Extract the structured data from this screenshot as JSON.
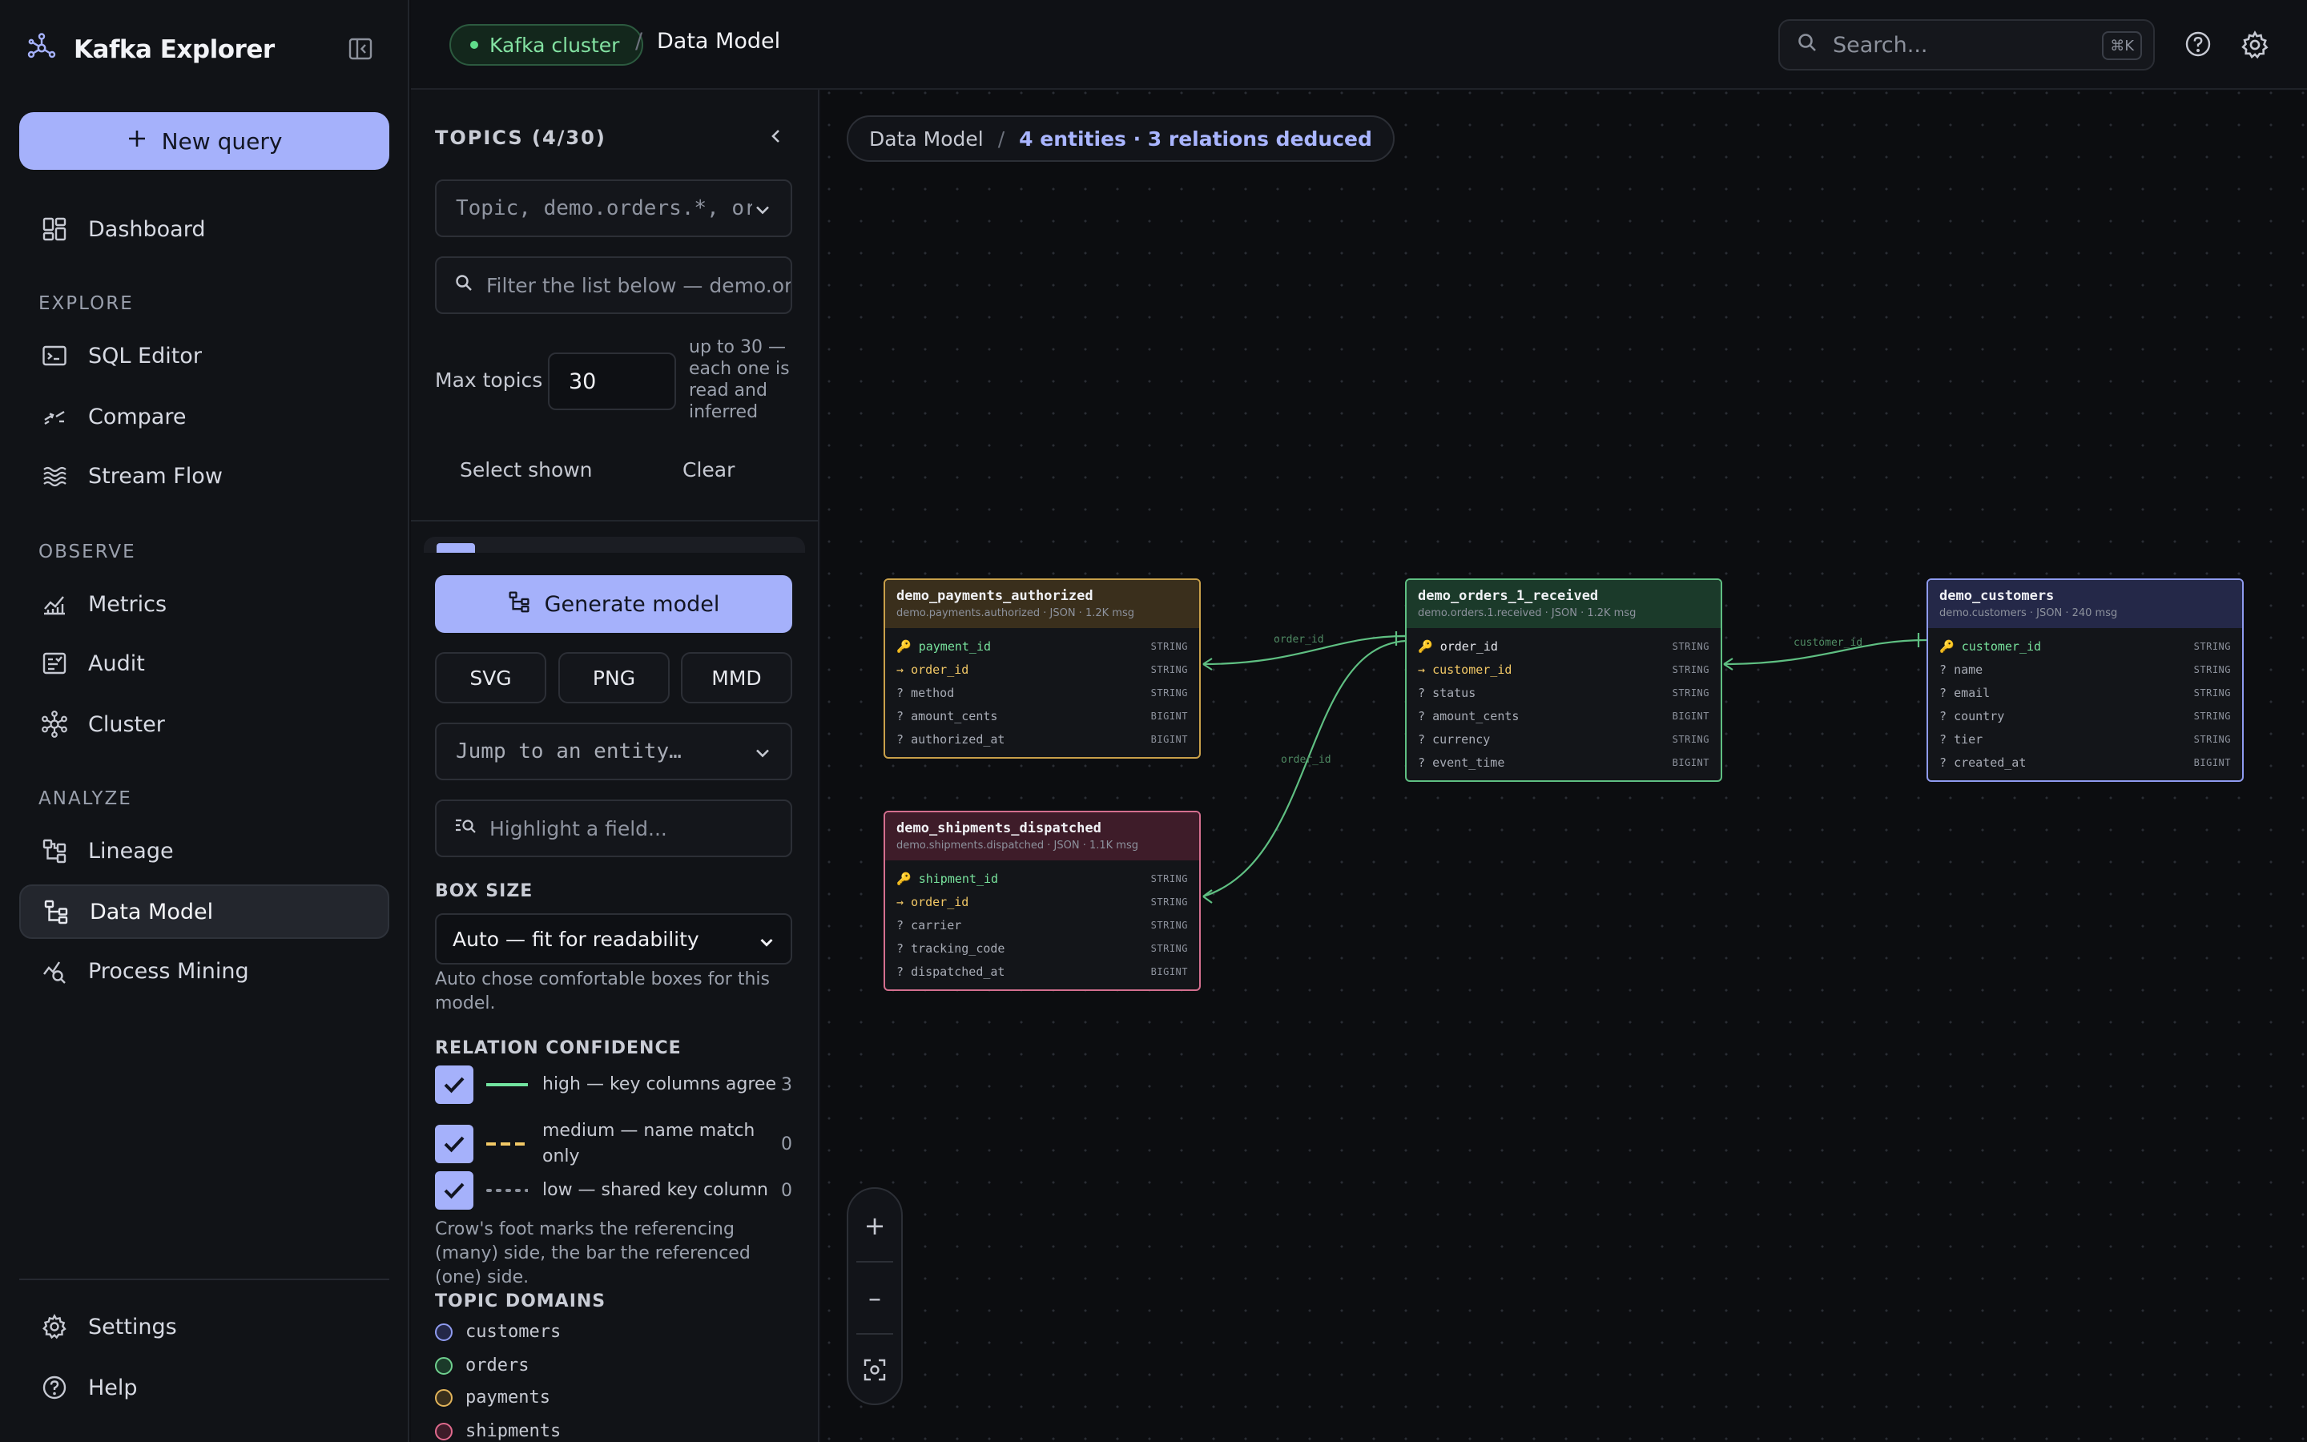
{
  "app": {
    "title": "Kafka Explorer"
  },
  "nav": {
    "new_query": "New query",
    "items_top": [
      {
        "label": "Dashboard",
        "icon": "dashboard-icon"
      }
    ],
    "sections": [
      {
        "title": "EXPLORE",
        "items": [
          {
            "label": "SQL Editor",
            "icon": "terminal-icon"
          },
          {
            "label": "Compare",
            "icon": "compare-icon"
          },
          {
            "label": "Stream Flow",
            "icon": "waves-icon"
          }
        ]
      },
      {
        "title": "OBSERVE",
        "items": [
          {
            "label": "Metrics",
            "icon": "metrics-icon"
          },
          {
            "label": "Audit",
            "icon": "audit-icon"
          },
          {
            "label": "Cluster",
            "icon": "cluster-icon"
          }
        ]
      },
      {
        "title": "ANALYZE",
        "items": [
          {
            "label": "Lineage",
            "icon": "lineage-icon"
          },
          {
            "label": "Data Model",
            "icon": "data-model-icon",
            "active": true
          },
          {
            "label": "Process Mining",
            "icon": "process-mining-icon"
          }
        ]
      }
    ],
    "footer": [
      {
        "label": "Settings",
        "icon": "gear-icon"
      },
      {
        "label": "Help",
        "icon": "help-icon"
      }
    ]
  },
  "topbar": {
    "cluster": "Kafka cluster",
    "separator": "/",
    "page": "Data Model",
    "search_placeholder": "Search...",
    "search_shortcut": "⌘K"
  },
  "topics_panel": {
    "title": "TOPICS (4/30)",
    "topic_pattern_placeholder": "Topic, demo.orders.*, or …",
    "filter_placeholder": "Filter the list below — demo.orders",
    "max_topics_label": "Max topics",
    "max_topics_value": "30",
    "max_topics_note": "up to 30 — each one is read and inferred",
    "select_shown": "Select shown",
    "clear": "Clear",
    "generate": "Generate model",
    "exports": [
      "SVG",
      "PNG",
      "MMD"
    ],
    "jump_placeholder": "Jump to an entity…",
    "highlight_placeholder": "Highlight a field...",
    "box_size_title": "BOX SIZE",
    "box_size_value": "Auto — fit for readability",
    "box_size_note": "Auto chose comfortable boxes for this model.",
    "confidence_title": "RELATION CONFIDENCE",
    "confidence": [
      {
        "label": "high — key columns agree",
        "count": "3",
        "color": "#72e3a0",
        "style": "solid"
      },
      {
        "label": "medium — name match only",
        "count": "0",
        "color": "#f2c866",
        "style": "dashed"
      },
      {
        "label": "low — shared key column",
        "count": "0",
        "color": "#8d929d",
        "style": "dotted"
      }
    ],
    "confidence_note": "Crow's foot marks the referencing (many) side, the bar the referenced (one) side.",
    "domains_title": "TOPIC DOMAINS",
    "domains": [
      {
        "name": "customers",
        "color": "#8f9bf0"
      },
      {
        "name": "orders",
        "color": "#6fcf8e"
      },
      {
        "name": "payments",
        "color": "#e2b45a"
      },
      {
        "name": "shipments",
        "color": "#e06a8d"
      }
    ]
  },
  "canvas": {
    "crumb_root": "Data Model",
    "crumb_sep": "/",
    "crumb_summary": "4 entities · 3 relations deduced",
    "edge_labels": [
      "order_id",
      "order_id",
      "customer_id"
    ],
    "entities": [
      {
        "name": "demo_payments_authorized",
        "meta": "demo.payments.authorized · JSON · 1.2K msg",
        "border": "#c9a04a",
        "header": "#3a2f1c",
        "fields": [
          {
            "mark": "🔑",
            "name": "payment_id",
            "type": "STRING",
            "kind": "pk"
          },
          {
            "mark": "→",
            "name": "order_id",
            "type": "STRING",
            "kind": "fk"
          },
          {
            "mark": "?",
            "name": "method",
            "type": "STRING",
            "kind": ""
          },
          {
            "mark": "?",
            "name": "amount_cents",
            "type": "BIGINT",
            "kind": ""
          },
          {
            "mark": "?",
            "name": "authorized_at",
            "type": "BIGINT",
            "kind": ""
          }
        ]
      },
      {
        "name": "demo_shipments_dispatched",
        "meta": "demo.shipments.dispatched · JSON · 1.1K msg",
        "border": "#d46f8f",
        "header": "#3e1c29",
        "fields": [
          {
            "mark": "🔑",
            "name": "shipment_id",
            "type": "STRING",
            "kind": "pk"
          },
          {
            "mark": "→",
            "name": "order_id",
            "type": "STRING",
            "kind": "fk"
          },
          {
            "mark": "?",
            "name": "carrier",
            "type": "STRING",
            "kind": ""
          },
          {
            "mark": "?",
            "name": "tracking_code",
            "type": "STRING",
            "kind": ""
          },
          {
            "mark": "?",
            "name": "dispatched_at",
            "type": "BIGINT",
            "kind": ""
          }
        ]
      },
      {
        "name": "demo_orders_1_received",
        "meta": "demo.orders.1.received · JSON · 1.2K msg",
        "border": "#5fbf82",
        "header": "#1b3a2a",
        "fields": [
          {
            "mark": "🔑",
            "name": "order_id",
            "type": "STRING",
            "kind": "pk"
          },
          {
            "mark": "→",
            "name": "customer_id",
            "type": "STRING",
            "kind": "fk"
          },
          {
            "mark": "?",
            "name": "status",
            "type": "STRING",
            "kind": ""
          },
          {
            "mark": "?",
            "name": "amount_cents",
            "type": "BIGINT",
            "kind": ""
          },
          {
            "mark": "?",
            "name": "currency",
            "type": "STRING",
            "kind": ""
          },
          {
            "mark": "?",
            "name": "event_time",
            "type": "BIGINT",
            "kind": ""
          }
        ]
      },
      {
        "name": "demo_customers",
        "meta": "demo.customers · JSON · 240 msg",
        "border": "#8f9bf0",
        "header": "#242848",
        "fields": [
          {
            "mark": "🔑",
            "name": "customer_id",
            "type": "STRING",
            "kind": "pk"
          },
          {
            "mark": "?",
            "name": "name",
            "type": "STRING",
            "kind": ""
          },
          {
            "mark": "?",
            "name": "email",
            "type": "STRING",
            "kind": ""
          },
          {
            "mark": "?",
            "name": "country",
            "type": "STRING",
            "kind": ""
          },
          {
            "mark": "?",
            "name": "tier",
            "type": "STRING",
            "kind": ""
          },
          {
            "mark": "?",
            "name": "created_at",
            "type": "BIGINT",
            "kind": ""
          }
        ]
      }
    ],
    "zoom": {
      "in": "+",
      "out": "–"
    }
  }
}
